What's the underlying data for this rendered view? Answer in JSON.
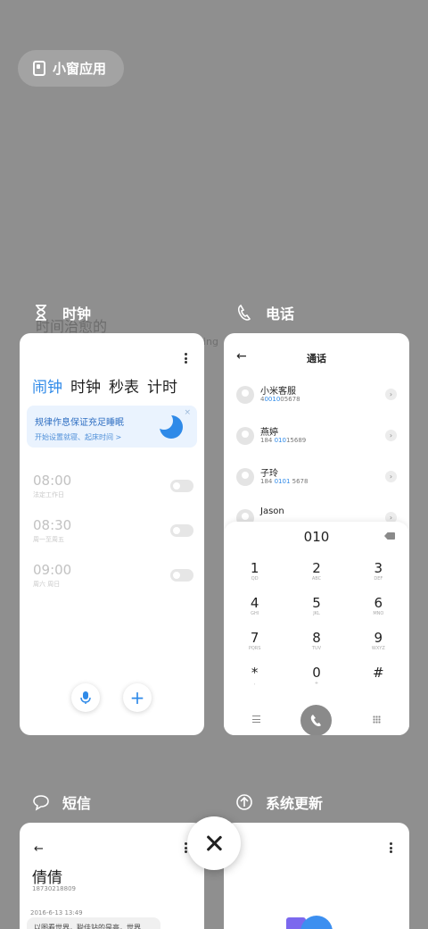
{
  "floating_window": {
    "label": "小窗应用",
    "icon": "window-icon"
  },
  "background_ghost": {
    "text1": "时间治愈的",
    "text2": "ing"
  },
  "clock": {
    "app_name": "时钟",
    "icon": "hourglass-icon",
    "tabs": [
      {
        "label": "闹钟",
        "active": true
      },
      {
        "label": "时钟",
        "active": false
      },
      {
        "label": "秒表",
        "active": false
      },
      {
        "label": "计时",
        "active": false
      }
    ],
    "banner": {
      "title": "规律作息保证充足睡眠",
      "subtitle": "开始设置就寝、起床时间 >",
      "close": "×"
    },
    "alarms": [
      {
        "time": "08:00",
        "label": "法定工作日",
        "enabled": false
      },
      {
        "time": "08:30",
        "label": "周一至周五",
        "enabled": false
      },
      {
        "time": "09:00",
        "label": "周六 周日",
        "enabled": false
      }
    ],
    "mic_icon": "microphone-icon",
    "add_label": "+"
  },
  "phone": {
    "app_name": "电话",
    "icon": "phone-icon",
    "title": "通话",
    "back": "←",
    "contacts": [
      {
        "name": "小米客服",
        "num_pre": "4",
        "num_hl": "0010",
        "num_post": "05678"
      },
      {
        "name": "燕婷",
        "num_pre": "184 ",
        "num_hl": "010",
        "num_post": "15689"
      },
      {
        "name": "子玲",
        "num_pre": "184 ",
        "num_hl": "0101",
        "num_post": " 5678"
      },
      {
        "name": "Jason",
        "num_pre": "",
        "num_hl": "",
        "num_post": ""
      }
    ],
    "dial_input": "010",
    "keys": [
      {
        "main": "1",
        "sub": "QD"
      },
      {
        "main": "2",
        "sub": "ABC"
      },
      {
        "main": "3",
        "sub": "DEF"
      },
      {
        "main": "4",
        "sub": "GHI"
      },
      {
        "main": "5",
        "sub": "JKL"
      },
      {
        "main": "6",
        "sub": "MNO"
      },
      {
        "main": "7",
        "sub": "PQRS"
      },
      {
        "main": "8",
        "sub": "TUV"
      },
      {
        "main": "9",
        "sub": "WXYZ"
      },
      {
        "main": "*",
        "sub": ","
      },
      {
        "main": "0",
        "sub": "+"
      },
      {
        "main": "#",
        "sub": ""
      }
    ],
    "call_icon": "handset-icon"
  },
  "messages": {
    "app_name": "短信",
    "icon": "chat-bubble-icon",
    "back": "←",
    "contact_name": "倩倩",
    "contact_number": "18730218809",
    "date": "2016-6-13 13:49",
    "bubble": "以图看世界，聪佳站的是高，世界"
  },
  "system_update": {
    "app_name": "系统更新",
    "icon": "update-arrow-icon"
  },
  "close_all": {
    "icon": "close-icon"
  },
  "colors": {
    "accent": "#2f8ae8",
    "background": "#8f8f8f"
  }
}
